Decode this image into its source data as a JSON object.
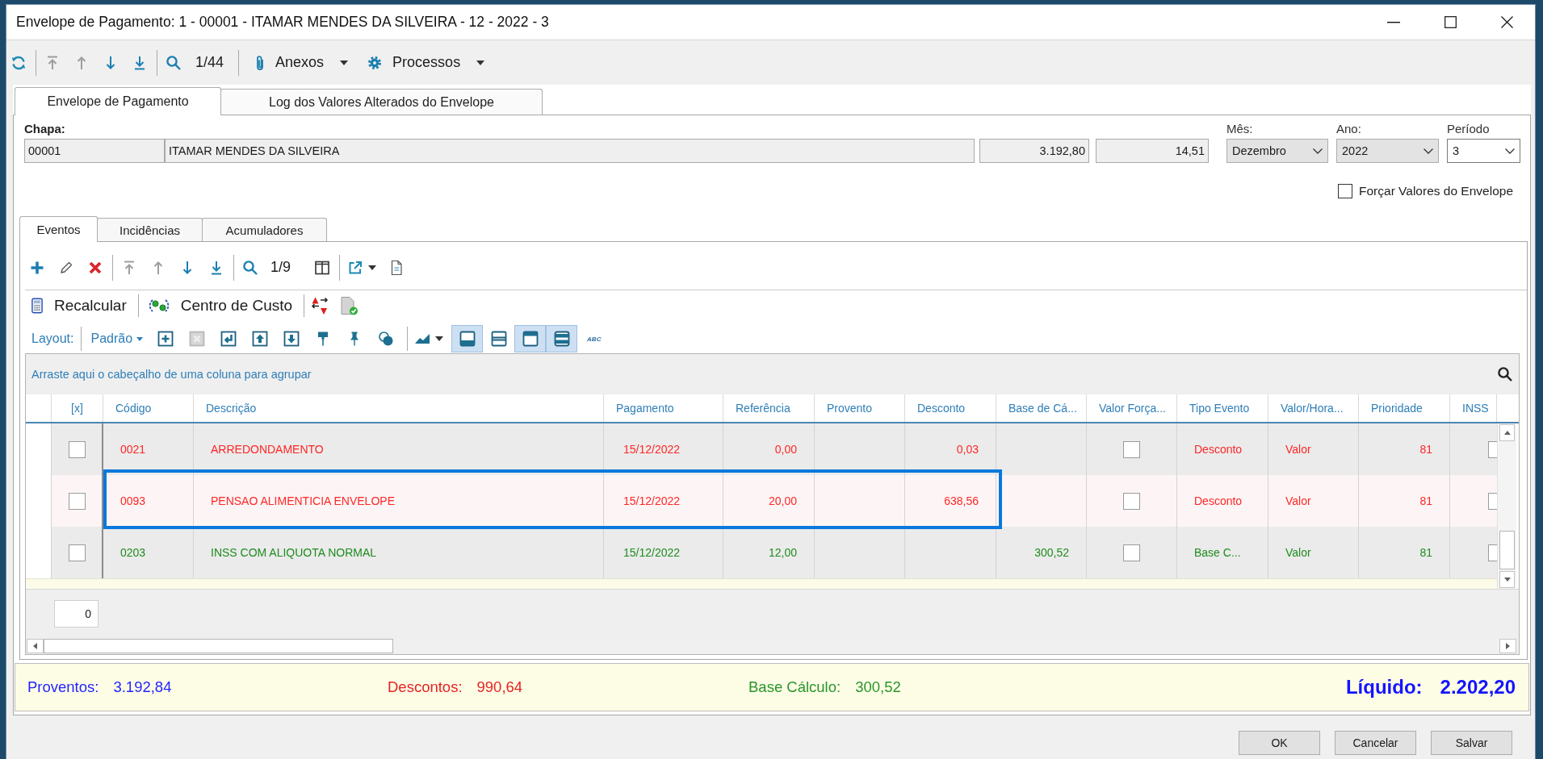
{
  "window": {
    "title": "Envelope de Pagamento: 1 - 00001 - ITAMAR MENDES DA SILVEIRA - 12 - 2022 - 3"
  },
  "toolbar": {
    "nav_buttons": [
      {
        "kind": "first",
        "disabled": true
      },
      {
        "kind": "previous",
        "disabled": true
      },
      {
        "kind": "next",
        "disabled": false
      },
      {
        "kind": "last",
        "disabled": false
      }
    ],
    "record_counter": "1/44",
    "menus": [
      {
        "kind": "attachments",
        "label": "Anexos"
      },
      {
        "kind": "processes",
        "label": "Processos"
      }
    ]
  },
  "tabs": [
    {
      "label": "Envelope de Pagamento",
      "selected": true
    },
    {
      "label": "Log dos Valores Alterados do Envelope",
      "selected": false
    }
  ],
  "header": {
    "chapa_label": "Chapa:",
    "fields": [
      {
        "kind": "text",
        "value": "00001"
      },
      {
        "kind": "text",
        "value": "ITAMAR MENDES DA SILVEIRA"
      },
      {
        "kind": "number",
        "value": "3.192,80"
      },
      {
        "kind": "number",
        "value": "14,51"
      }
    ],
    "selects": [
      {
        "label": "Mês:",
        "value": "Dezembro",
        "disabled": true
      },
      {
        "label": "Ano:",
        "value": "2022",
        "disabled": true
      },
      {
        "label": "Período",
        "value": "3",
        "disabled": false
      }
    ],
    "force_values": {
      "label": "Forçar Valores do Envelope",
      "checked": false
    }
  },
  "sub_tabs": [
    {
      "label": "Eventos",
      "selected": true
    },
    {
      "label": "Incidências",
      "selected": false
    },
    {
      "label": "Acumuladores",
      "selected": false
    }
  ],
  "events_toolbar": {
    "nav_buttons": [
      {
        "kind": "first",
        "disabled": true
      },
      {
        "kind": "previous",
        "disabled": true
      },
      {
        "kind": "next",
        "disabled": false
      },
      {
        "kind": "last",
        "disabled": false
      }
    ],
    "record_counter": "1/9"
  },
  "actions": [
    {
      "kind": "recalculate",
      "label": "Recalcular"
    },
    {
      "kind": "cost_center",
      "label": "Centro de Custo"
    }
  ],
  "layout_bar": {
    "label": "Layout:",
    "preset": "Padrão",
    "tools": [
      {
        "kind": "add_row",
        "disabled": false
      },
      {
        "kind": "delete_row",
        "disabled": true
      },
      {
        "kind": "enter",
        "disabled": false
      },
      {
        "kind": "move_up",
        "disabled": false
      },
      {
        "kind": "move_down",
        "disabled": false
      },
      {
        "kind": "brush",
        "disabled": false
      },
      {
        "kind": "pin",
        "disabled": false
      },
      {
        "kind": "shapes",
        "disabled": false
      }
    ],
    "view_toggles": [
      {
        "kind": "bottom",
        "selected": true
      },
      {
        "kind": "middle",
        "selected": false
      },
      {
        "kind": "top",
        "selected": true
      },
      {
        "kind": "double",
        "selected": true
      }
    ],
    "text_style": "ABC"
  },
  "grid": {
    "group_hint": "Arraste aqui o cabeçalho de uma coluna para agrupar",
    "columns": [
      "[x]",
      "Código",
      "Descrição",
      "Pagamento",
      "Referência",
      "Provento",
      "Desconto",
      "Base de Cá...",
      "Valor Força...",
      "Tipo Evento",
      "Valor/Hora...",
      "Prioridade",
      "INSS"
    ],
    "rows": [
      {
        "selected": false,
        "highlighted": false,
        "color": "#ff2626",
        "marked": false,
        "codigo": "0021",
        "descricao": "ARREDONDAMENTO",
        "pagamento": "15/12/2022",
        "referencia": "0,00",
        "desconto": "0,03",
        "valor_forcado": false,
        "tipo_evento": "Desconto",
        "valor_hora": "Valor",
        "prioridade": "81",
        "inss": false
      },
      {
        "selected": true,
        "highlighted": true,
        "color": "#ff2626",
        "marked": false,
        "codigo": "0093",
        "descricao": "PENSAO ALIMENTICIA ENVELOPE",
        "pagamento": "15/12/2022",
        "referencia": "20,00",
        "desconto": "638,56",
        "valor_forcado": false,
        "tipo_evento": "Desconto",
        "valor_hora": "Valor",
        "prioridade": "81",
        "inss": false
      },
      {
        "selected": false,
        "highlighted": false,
        "color": "#1e8c1e",
        "marked": false,
        "codigo": "0203",
        "descricao": "INSS COM ALIQUOTA NORMAL",
        "pagamento": "15/12/2022",
        "referencia": "12,00",
        "base_calculo": "300,52",
        "valor_forcado": false,
        "tipo_evento": "Base C...",
        "valor_hora": "Valor",
        "prioridade": "81",
        "inss": false
      }
    ],
    "footer_value": "0"
  },
  "summary": [
    {
      "kind": "subtotal",
      "label": "Proventos:",
      "value": "3.192,84",
      "color": "#2424ff"
    },
    {
      "kind": "subtotal",
      "label": "Descontos:",
      "value": "990,64",
      "color": "#e62222"
    },
    {
      "kind": "subtotal",
      "label": "Base Cálculo:",
      "value": "300,52",
      "color": "#2a962a"
    },
    {
      "kind": "total",
      "label": "Líquido:",
      "value": "2.202,20",
      "color": "#1414ff"
    }
  ],
  "buttons": [
    "OK",
    "Cancelar",
    "Salvar"
  ]
}
